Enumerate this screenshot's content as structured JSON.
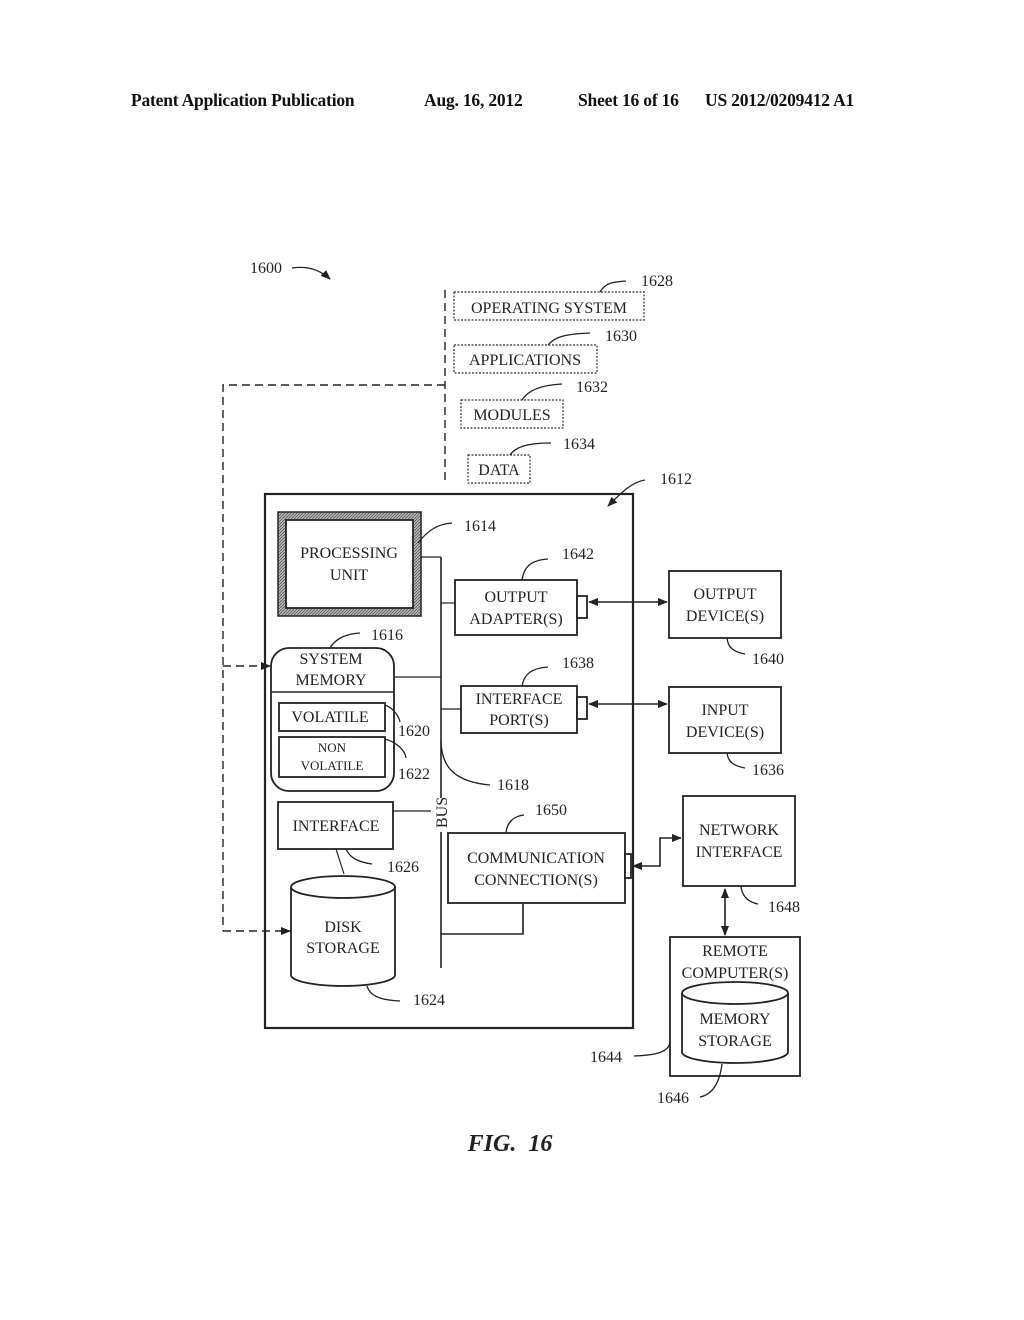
{
  "header": {
    "publication": "Patent Application Publication",
    "date": "Aug. 16, 2012",
    "sheet": "Sheet 16 of 16",
    "number": "US 2012/0209412 A1"
  },
  "figure": {
    "caption": "FIG.  16",
    "system_ref": "1600",
    "computer_ref": "1612",
    "software": [
      {
        "label": "OPERATING SYSTEM",
        "ref": "1628"
      },
      {
        "label": "APPLICATIONS",
        "ref": "1630"
      },
      {
        "label": "MODULES",
        "ref": "1632"
      },
      {
        "label": "DATA",
        "ref": "1634"
      }
    ],
    "processing_unit": {
      "line1": "PROCESSING",
      "line2": "UNIT",
      "ref": "1614"
    },
    "system_memory": {
      "line1": "SYSTEM",
      "line2": "MEMORY",
      "ref": "1616"
    },
    "volatile": {
      "label": "VOLATILE",
      "ref": "1620"
    },
    "nonvolatile": {
      "line1": "NON",
      "line2": "VOLATILE",
      "ref": "1622"
    },
    "bus": {
      "label": "BUS",
      "ref": "1618"
    },
    "interface": {
      "label": "INTERFACE",
      "ref": "1626"
    },
    "disk_storage": {
      "line1": "DISK",
      "line2": "STORAGE",
      "ref": "1624"
    },
    "output_adapter": {
      "line1": "OUTPUT",
      "line2": "ADAPTER(S)",
      "ref": "1642"
    },
    "interface_port": {
      "line1": "INTERFACE",
      "line2": "PORT(S)",
      "ref": "1638"
    },
    "comm_connection": {
      "line1": "COMMUNICATION",
      "line2": "CONNECTION(S)",
      "ref": "1650"
    },
    "output_device": {
      "line1": "OUTPUT",
      "line2": "DEVICE(S)",
      "ref": "1640"
    },
    "input_device": {
      "line1": "INPUT",
      "line2": "DEVICE(S)",
      "ref": "1636"
    },
    "network_interface": {
      "line1": "NETWORK",
      "line2": "INTERFACE",
      "ref": "1648"
    },
    "remote_computer": {
      "line1": "REMOTE",
      "line2": "COMPUTER(S)",
      "ref": "1644"
    },
    "memory_storage": {
      "line1": "MEMORY",
      "line2": "STORAGE",
      "ref": "1646"
    }
  }
}
